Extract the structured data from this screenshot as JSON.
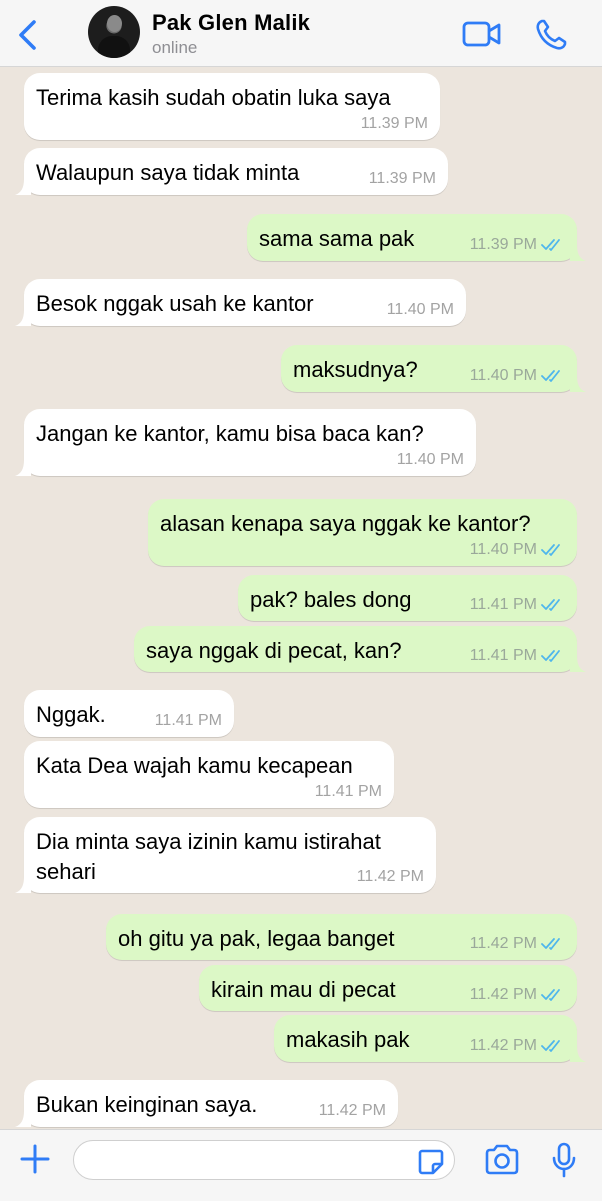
{
  "header": {
    "contact_name": "Pak Glen Malik",
    "status": "online",
    "back_icon": "chevron-left-icon",
    "video_icon": "video-camera-icon",
    "call_icon": "phone-icon",
    "accent_color": "#2f7cf6"
  },
  "messages": [
    {
      "dir": "in",
      "text": "Terima kasih sudah obatin luka saya",
      "time": "11.39 PM"
    },
    {
      "dir": "in",
      "text": "Walaupun saya tidak minta",
      "time": "11.39 PM"
    },
    {
      "dir": "out",
      "text": "sama sama pak",
      "time": "11.39 PM",
      "read": true
    },
    {
      "dir": "in",
      "text": "Besok nggak usah ke kantor",
      "time": "11.40 PM"
    },
    {
      "dir": "out",
      "text": "maksudnya?",
      "time": "11.40 PM",
      "read": true
    },
    {
      "dir": "in",
      "text": "Jangan ke kantor, kamu bisa baca kan?",
      "time": "11.40 PM"
    },
    {
      "dir": "out",
      "text": "alasan kenapa saya nggak ke kantor?",
      "time": "11.40 PM",
      "read": true
    },
    {
      "dir": "out",
      "text": "pak? bales dong",
      "time": "11.41 PM",
      "read": true
    },
    {
      "dir": "out",
      "text": "saya nggak di pecat, kan?",
      "time": "11.41 PM",
      "read": true
    },
    {
      "dir": "in",
      "text": "Nggak.",
      "time": "11.41 PM"
    },
    {
      "dir": "in",
      "text": "Kata Dea wajah kamu kecapean",
      "time": "11.41 PM"
    },
    {
      "dir": "in",
      "text": "Dia minta saya izinin kamu istirahat\nsehari",
      "time": "11.42 PM"
    },
    {
      "dir": "out",
      "text": "oh gitu ya pak, legaa banget",
      "time": "11.42 PM",
      "read": true
    },
    {
      "dir": "out",
      "text": "kirain mau di pecat",
      "time": "11.42 PM",
      "read": true
    },
    {
      "dir": "out",
      "text": "makasih pak",
      "time": "11.42 PM",
      "read": true
    },
    {
      "dir": "in",
      "text": "Bukan keinginan saya.",
      "time": "11.42 PM"
    }
  ],
  "composer": {
    "plus_icon": "plus-icon",
    "input_value": "",
    "sticker_icon": "sticker-icon",
    "camera_icon": "camera-icon",
    "mic_icon": "microphone-icon"
  },
  "colors": {
    "chat_background": "#ece5dd",
    "incoming_bubble": "#ffffff",
    "outgoing_bubble": "#dcf8c6",
    "read_tick": "#4fb6ec"
  }
}
